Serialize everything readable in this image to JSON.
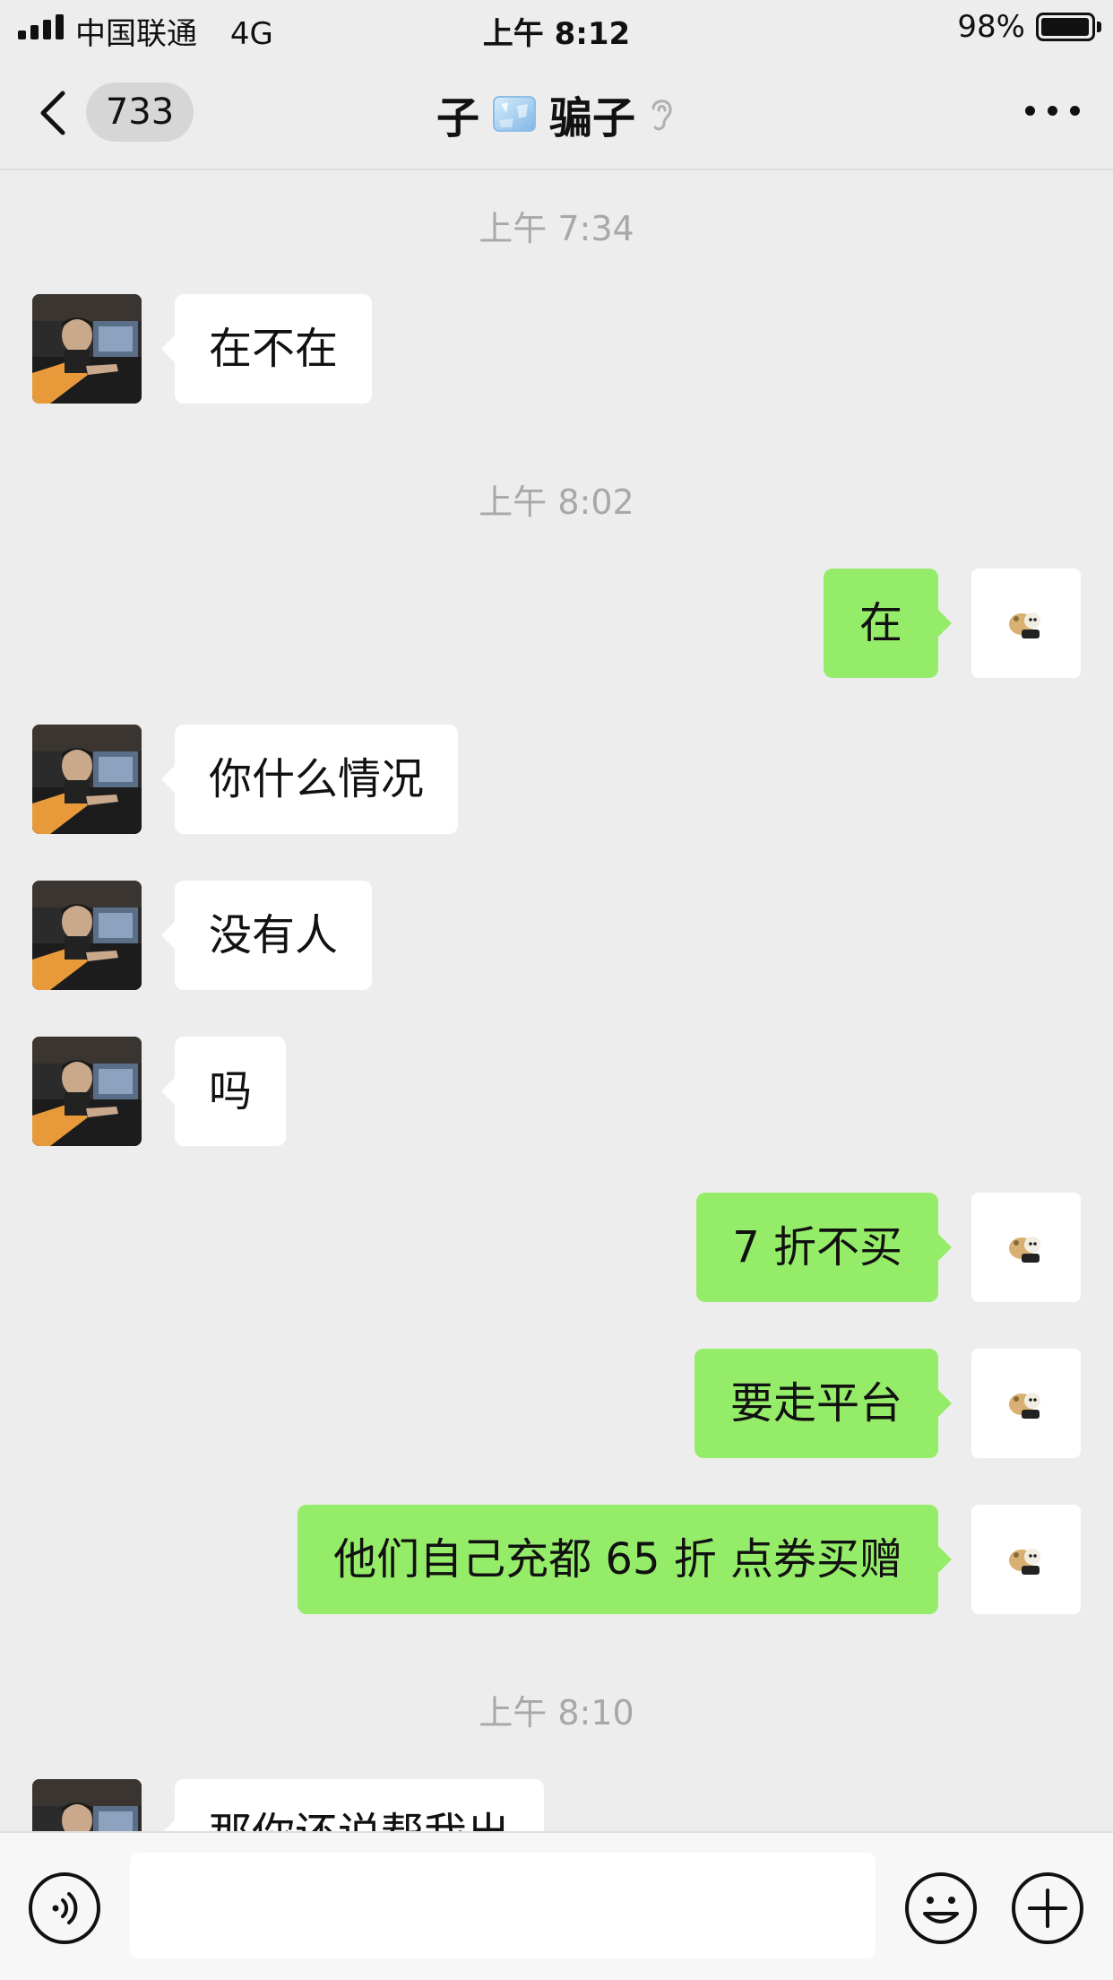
{
  "status_bar": {
    "carrier": "中国联通",
    "network": "4G",
    "time": "上午 8:12",
    "battery": "98%",
    "battery_level": 0.98
  },
  "nav": {
    "unread_count": "733",
    "title_left": "子",
    "title_icon": "ice-cube-icon",
    "title_right": "骗子",
    "muted_icon": "ear-icon",
    "more_icon": "more-dots-icon"
  },
  "messages": [
    {
      "type": "time",
      "text": "上午 7:34"
    },
    {
      "type": "in",
      "text": "在不在"
    },
    {
      "type": "time",
      "text": "上午 8:02"
    },
    {
      "type": "out",
      "text": "在"
    },
    {
      "type": "in",
      "text": "你什么情况"
    },
    {
      "type": "in",
      "text": "没有人"
    },
    {
      "type": "in",
      "text": "吗"
    },
    {
      "type": "out",
      "text": "7 折不买"
    },
    {
      "type": "out",
      "text": "要走平台"
    },
    {
      "type": "out",
      "text": "他们自己充都 65 折 点券买赠"
    },
    {
      "type": "time",
      "text": "上午 8:10"
    },
    {
      "type": "in",
      "text": "那你还说帮我出"
    }
  ],
  "input_bar": {
    "placeholder": "",
    "voice_icon": "voice-icon",
    "emoji_icon": "emoji-icon",
    "plus_icon": "plus-icon"
  }
}
